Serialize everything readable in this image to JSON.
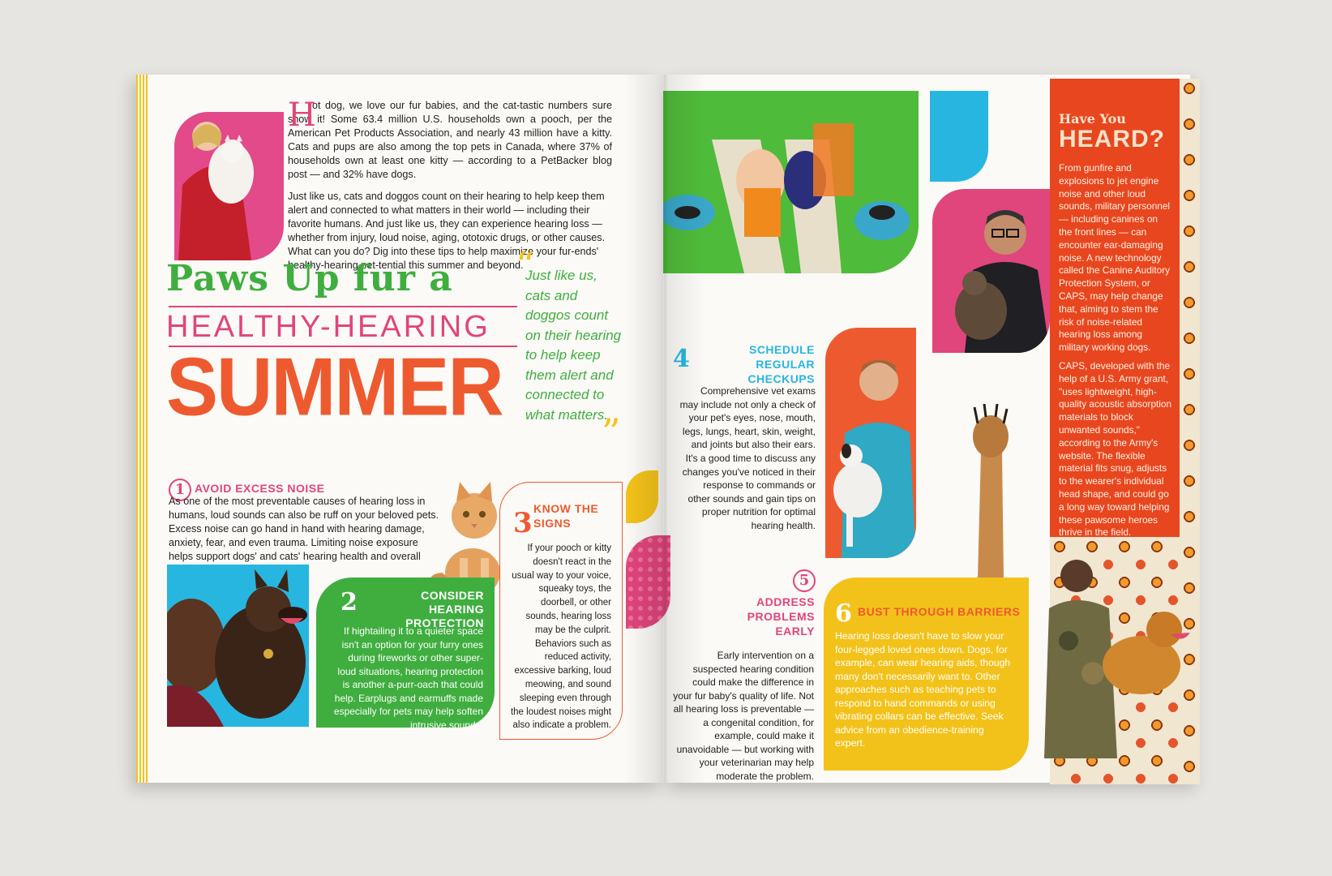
{
  "intro": {
    "drop_cap": "H",
    "paragraph1": "ot dog, we love our fur babies, and the cat-tastic numbers sure show it! Some 63.4 million U.S. households own a pooch, per the American Pet Products Association, and nearly 43 million have a kitty. Cats and pups are also among the top pets in Canada, where 37% of households own at least one kitty — according to a PetBacker blog post — and 32% have dogs.",
    "paragraph2": "Just like us, cats and doggos count on their hearing to help keep them alert and connected to what matters in their world — including their favorite humans. And just like us, they can experience hearing loss — whether from injury, loud noise, aging, ototoxic drugs, or other causes. What can you do? Dig into these tips to help maximize your fur-ends' healthy-hearing pet-tential this summer and beyond."
  },
  "headline": {
    "line1": "Paws Up fur a",
    "line2": "HEALTHY-HEARING",
    "line3": "SUMMER"
  },
  "pull_quote": {
    "open": "“",
    "text": "Just like us, cats and doggos count on their hearing to help keep them alert and connected to what matters.",
    "close": "”"
  },
  "tips": [
    {
      "number": "1",
      "title": "AVOID EXCESS NOISE",
      "body": "As one of the most preventable causes of hearing loss in humans, loud sounds can also be ruff on your beloved pets. Excess noise can go hand in hand with hearing damage, anxiety, fear, and even trauma. Limiting noise exposure helps support dogs' and cats' hearing health and overall wellness."
    },
    {
      "number": "2",
      "title": "CONSIDER HEARING PROTECTION",
      "body": "If hightailing it to a quieter space isn't an option for your furry ones during fireworks or other super-loud situations, hearing protection is another a-purr-oach that could help. Earplugs and earmuffs made especially for pets may help soften intrusive sounds."
    },
    {
      "number": "3",
      "title": "KNOW THE SIGNS",
      "body": "If your pooch or kitty doesn't react in the usual way to your voice, squeaky toys, the doorbell, or other sounds, hearing loss may be the culprit. Behaviors such as reduced activity, excessive barking, loud meowing, and sound sleeping even through the loudest noises might also indicate a problem."
    },
    {
      "number": "4",
      "title": "SCHEDULE REGULAR CHECKUPS",
      "body": "Comprehensive vet exams may include not only a check of your pet's eyes, nose, mouth, legs, lungs, heart, skin, weight, and joints but also their ears. It's a good time to discuss any changes you've noticed in their response to commands or other sounds and gain tips on proper nutrition for optimal hearing health."
    },
    {
      "number": "5",
      "title": "ADDRESS PROBLEMS EARLY",
      "body": "Early intervention on a suspected hearing condition could make the difference in your fur baby's quality of life. Not all hearing loss is preventable — a congenital condition, for example, could make it unavoidable — but working with your veterinarian may help moderate the problem."
    },
    {
      "number": "6",
      "title": "BUST THROUGH BARRIERS",
      "body": "Hearing loss doesn't have to slow your four-legged loved ones down. Dogs, for example, can wear hearing aids, though many don't necessarily want to. Other approaches such as teaching pets to respond to hand commands or using vibrating collars can be effective. Seek advice from an obedience-training expert."
    }
  ],
  "sidebar": {
    "kicker": "Have You",
    "title": "HEARD?",
    "paragraph1": "From gunfire and explosions to jet engine noise and other loud sounds, military personnel — including canines on the front lines — can encounter ear-damaging noise. A new technology called the Canine Auditory Protection System, or CAPS, may help change that, aiming to stem the risk of noise-related hearing loss among military working dogs.",
    "paragraph2": "CAPS, developed with the help of a U.S. Army grant, \"uses lightweight, high-quality acoustic absorption materials to block unwanted sounds,\" according to the Army's website. The flexible material fits snug, adjusts to the wearer's individual head shape, and could go a long way toward helping these pawsome heroes thrive in the field."
  },
  "colors": {
    "green": "#3fae3f",
    "pink": "#e0457b",
    "orange": "#ee5a2f",
    "blue": "#2fb3d9",
    "yellow": "#f3c21a",
    "red_sidebar": "#e8461f"
  }
}
